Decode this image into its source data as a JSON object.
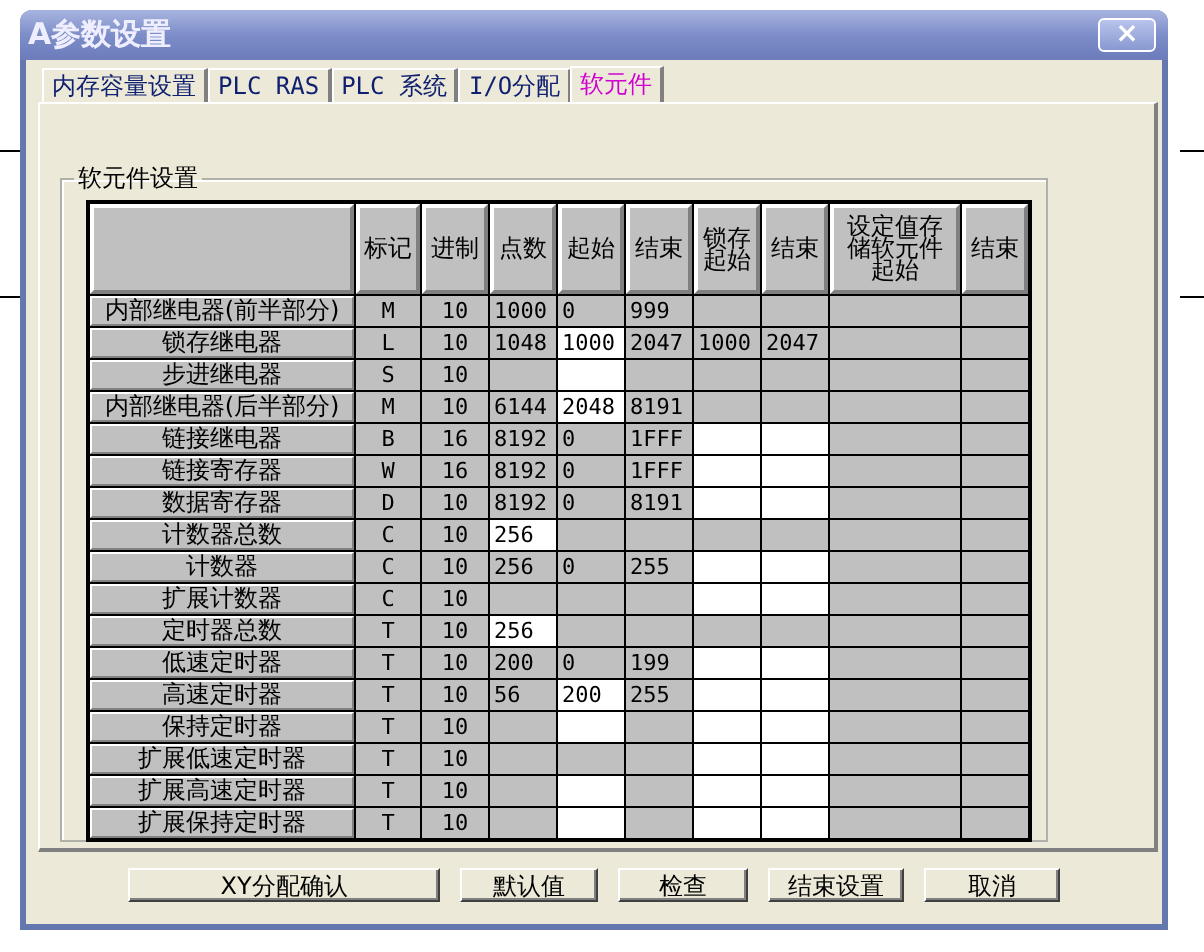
{
  "window": {
    "title": "A参数设置",
    "close": "×"
  },
  "tabs": [
    {
      "label": "内存容量设置",
      "selected": false
    },
    {
      "label": "PLC RAS",
      "selected": false
    },
    {
      "label": "PLC 系统",
      "selected": false
    },
    {
      "label": "I/O分配",
      "selected": false
    },
    {
      "label": "软元件",
      "selected": true
    }
  ],
  "group": {
    "title": "软元件设置"
  },
  "table": {
    "columns": [
      "",
      "标记",
      "进制",
      "点数",
      "起始",
      "结束",
      "锁存起始",
      "结束",
      "设定值存储软元件起始",
      "结束"
    ],
    "rows": [
      {
        "cells": [
          {
            "text": "内部继电器(前半部分)"
          },
          {
            "text": "M"
          },
          {
            "text": "10"
          },
          {
            "text": "1000",
            "editable": false
          },
          {
            "text": "0",
            "editable": false
          },
          {
            "text": "999",
            "editable": false
          },
          {
            "editable": false
          },
          {
            "editable": false
          },
          {
            "editable": false
          },
          {
            "editable": false
          }
        ]
      },
      {
        "cells": [
          {
            "text": "锁存继电器"
          },
          {
            "text": "L"
          },
          {
            "text": "10"
          },
          {
            "text": "1048",
            "editable": false
          },
          {
            "text": "1000",
            "editable": true
          },
          {
            "text": "2047",
            "editable": false
          },
          {
            "text": "1000",
            "editable": false
          },
          {
            "text": "2047",
            "editable": false
          },
          {
            "editable": false
          },
          {
            "editable": false
          }
        ]
      },
      {
        "cells": [
          {
            "text": "步进继电器"
          },
          {
            "text": "S"
          },
          {
            "text": "10"
          },
          {
            "editable": false
          },
          {
            "editable": true
          },
          {
            "editable": false
          },
          {
            "editable": false
          },
          {
            "editable": false
          },
          {
            "editable": false
          },
          {
            "editable": false
          }
        ]
      },
      {
        "cells": [
          {
            "text": "内部继电器(后半部分)"
          },
          {
            "text": "M"
          },
          {
            "text": "10"
          },
          {
            "text": "6144",
            "editable": false
          },
          {
            "text": "2048",
            "editable": true
          },
          {
            "text": "8191",
            "editable": false
          },
          {
            "editable": false
          },
          {
            "editable": false
          },
          {
            "editable": false
          },
          {
            "editable": false
          }
        ]
      },
      {
        "cells": [
          {
            "text": "链接继电器"
          },
          {
            "text": "B"
          },
          {
            "text": "16"
          },
          {
            "text": "8192",
            "editable": false
          },
          {
            "text": "0",
            "editable": false
          },
          {
            "text": "1FFF",
            "editable": false
          },
          {
            "editable": true
          },
          {
            "editable": true
          },
          {
            "editable": false
          },
          {
            "editable": false
          }
        ]
      },
      {
        "cells": [
          {
            "text": "链接寄存器"
          },
          {
            "text": "W"
          },
          {
            "text": "16"
          },
          {
            "text": "8192",
            "editable": false
          },
          {
            "text": "0",
            "editable": false
          },
          {
            "text": "1FFF",
            "editable": false
          },
          {
            "editable": true
          },
          {
            "editable": true
          },
          {
            "editable": false
          },
          {
            "editable": false
          }
        ]
      },
      {
        "cells": [
          {
            "text": "数据寄存器"
          },
          {
            "text": "D"
          },
          {
            "text": "10"
          },
          {
            "text": "8192",
            "editable": false
          },
          {
            "text": "0",
            "editable": false
          },
          {
            "text": "8191",
            "editable": false
          },
          {
            "editable": true
          },
          {
            "editable": true
          },
          {
            "editable": false
          },
          {
            "editable": false
          }
        ]
      },
      {
        "cells": [
          {
            "text": "计数器总数"
          },
          {
            "text": "C"
          },
          {
            "text": "10"
          },
          {
            "text": "256",
            "editable": true
          },
          {
            "editable": false
          },
          {
            "editable": false
          },
          {
            "editable": false
          },
          {
            "editable": false
          },
          {
            "editable": false
          },
          {
            "editable": false
          }
        ]
      },
      {
        "cells": [
          {
            "text": "计数器"
          },
          {
            "text": "C"
          },
          {
            "text": "10"
          },
          {
            "text": "256",
            "editable": false
          },
          {
            "text": "0",
            "editable": false
          },
          {
            "text": "255",
            "editable": false
          },
          {
            "editable": true
          },
          {
            "editable": true
          },
          {
            "editable": false
          },
          {
            "editable": false
          }
        ]
      },
      {
        "cells": [
          {
            "text": "扩展计数器"
          },
          {
            "text": "C"
          },
          {
            "text": "10"
          },
          {
            "editable": false
          },
          {
            "editable": false
          },
          {
            "editable": false
          },
          {
            "editable": true
          },
          {
            "editable": true
          },
          {
            "editable": false
          },
          {
            "editable": false
          }
        ]
      },
      {
        "cells": [
          {
            "text": "定时器总数"
          },
          {
            "text": "T"
          },
          {
            "text": "10"
          },
          {
            "text": "256",
            "editable": true
          },
          {
            "editable": false
          },
          {
            "editable": false
          },
          {
            "editable": false
          },
          {
            "editable": false
          },
          {
            "editable": false
          },
          {
            "editable": false
          }
        ]
      },
      {
        "cells": [
          {
            "text": "低速定时器"
          },
          {
            "text": "T"
          },
          {
            "text": "10"
          },
          {
            "text": "200",
            "editable": false
          },
          {
            "text": "0",
            "editable": false
          },
          {
            "text": "199",
            "editable": false
          },
          {
            "editable": true
          },
          {
            "editable": true
          },
          {
            "editable": false
          },
          {
            "editable": false
          }
        ]
      },
      {
        "cells": [
          {
            "text": "高速定时器"
          },
          {
            "text": "T"
          },
          {
            "text": "10"
          },
          {
            "text": "56",
            "editable": false
          },
          {
            "text": "200",
            "editable": true
          },
          {
            "text": "255",
            "editable": false
          },
          {
            "editable": true
          },
          {
            "editable": true
          },
          {
            "editable": false
          },
          {
            "editable": false
          }
        ]
      },
      {
        "cells": [
          {
            "text": "保持定时器"
          },
          {
            "text": "T"
          },
          {
            "text": "10"
          },
          {
            "editable": false
          },
          {
            "editable": true
          },
          {
            "editable": false
          },
          {
            "editable": true
          },
          {
            "editable": true
          },
          {
            "editable": false
          },
          {
            "editable": false
          }
        ]
      },
      {
        "cells": [
          {
            "text": "扩展低速定时器"
          },
          {
            "text": "T"
          },
          {
            "text": "10"
          },
          {
            "editable": false
          },
          {
            "editable": false
          },
          {
            "editable": false
          },
          {
            "editable": true
          },
          {
            "editable": true
          },
          {
            "editable": false
          },
          {
            "editable": false
          }
        ]
      },
      {
        "cells": [
          {
            "text": "扩展高速定时器"
          },
          {
            "text": "T"
          },
          {
            "text": "10"
          },
          {
            "editable": false
          },
          {
            "editable": true
          },
          {
            "editable": false
          },
          {
            "editable": true
          },
          {
            "editable": true
          },
          {
            "editable": false
          },
          {
            "editable": false
          }
        ]
      },
      {
        "cells": [
          {
            "text": "扩展保持定时器"
          },
          {
            "text": "T"
          },
          {
            "text": "10"
          },
          {
            "editable": false
          },
          {
            "editable": true
          },
          {
            "editable": false
          },
          {
            "editable": true
          },
          {
            "editable": true
          },
          {
            "editable": false
          },
          {
            "editable": false
          }
        ]
      }
    ]
  },
  "buttons": [
    "XY分配确认",
    "默认值",
    "检查",
    "结束设置",
    "取消"
  ]
}
